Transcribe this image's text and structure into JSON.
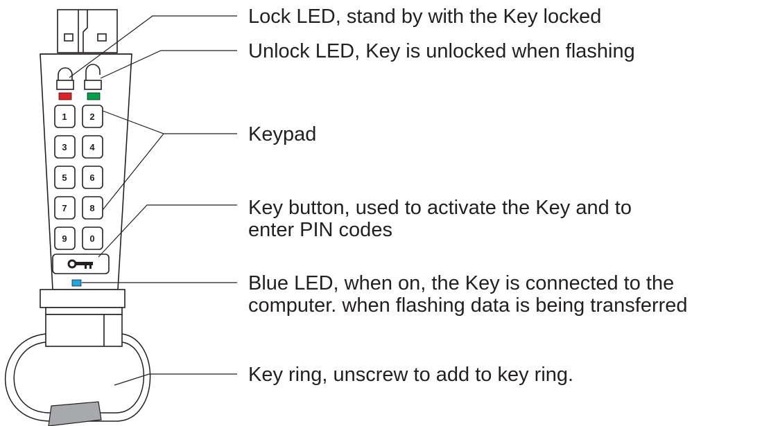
{
  "callouts": [
    {
      "id": "lock-led",
      "lines": [
        "Lock LED, stand by with the Key locked"
      ]
    },
    {
      "id": "unlock-led",
      "lines": [
        "Unlock LED, Key is unlocked when flashing"
      ]
    },
    {
      "id": "keypad",
      "lines": [
        "Keypad"
      ]
    },
    {
      "id": "key-button",
      "lines": [
        "Key button, used to activate the Key and to",
        "enter PIN codes"
      ]
    },
    {
      "id": "blue-led",
      "lines": [
        "Blue LED, when on, the Key is connected to the",
        "computer. when flashing data is being transferred"
      ]
    },
    {
      "id": "key-ring",
      "lines": [
        "Key ring, unscrew to add to key ring."
      ]
    }
  ],
  "keypad": {
    "keys": [
      "1",
      "2",
      "3",
      "4",
      "5",
      "6",
      "7",
      "8",
      "9",
      "0"
    ],
    "key_button_icon": "key-icon"
  },
  "leds": {
    "lock_color": "#e02129",
    "unlock_color": "#00a14b",
    "blue_color": "#1ea7e0"
  },
  "colors": {
    "stroke": "#231f20",
    "ring_tab": "#a7a9ac"
  }
}
